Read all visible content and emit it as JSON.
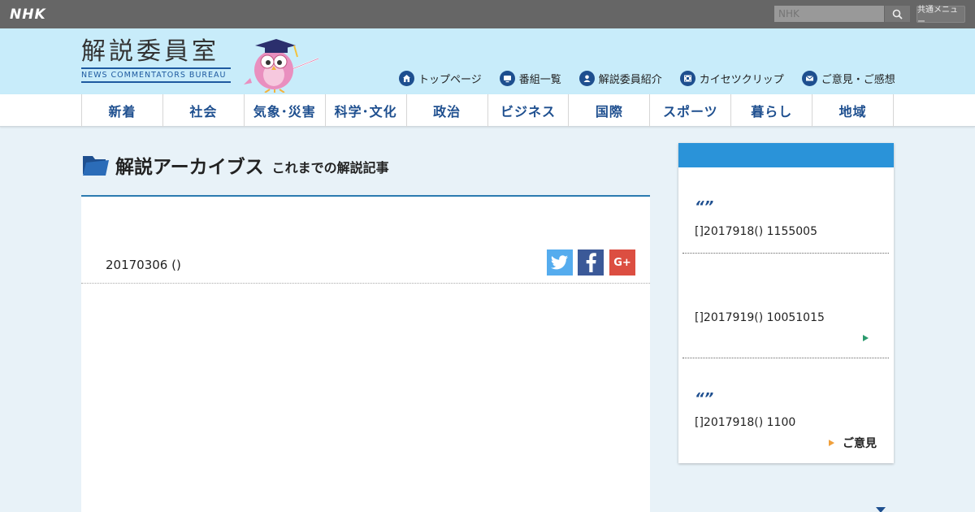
{
  "topbar": {
    "logo": "NHK",
    "search_placeholder": "NHK",
    "common_menu": "共通メニュー"
  },
  "header": {
    "title": "解説委員室",
    "subtitle": "NEWS COMMENTATORS BUREAU",
    "nav": [
      {
        "label": "トップページ",
        "icon": "home-icon"
      },
      {
        "label": "番組一覧",
        "icon": "tv-icon"
      },
      {
        "label": "解説委員紹介",
        "icon": "person-icon"
      },
      {
        "label": "カイセツクリップ",
        "icon": "film-icon"
      },
      {
        "label": "ご意見・ご感想",
        "icon": "mail-icon"
      }
    ]
  },
  "categories": [
    "新着",
    "社会",
    "気象･災害",
    "科学･文化",
    "政治",
    "ビジネス",
    "国際",
    "スポーツ",
    "暮らし",
    "地域"
  ],
  "archive": {
    "title": "解説アーカイブス",
    "subtitle": "これまでの解説記事"
  },
  "article": {
    "date": "20170306 ()",
    "share_gplus": "G+"
  },
  "sidebar": {
    "items": [
      {
        "quote": "“”",
        "text": "[]2017918() 1155005"
      },
      {
        "text": "[]2017919() 10051015"
      },
      {
        "quote": "“”",
        "text": "[]2017918() 1100"
      }
    ],
    "link_label": "ご意見"
  },
  "colors": {
    "topbar": "#666666",
    "header": "#c8ecfa",
    "accent": "#1e4f8f",
    "sidebar_head": "#2a93d9"
  }
}
